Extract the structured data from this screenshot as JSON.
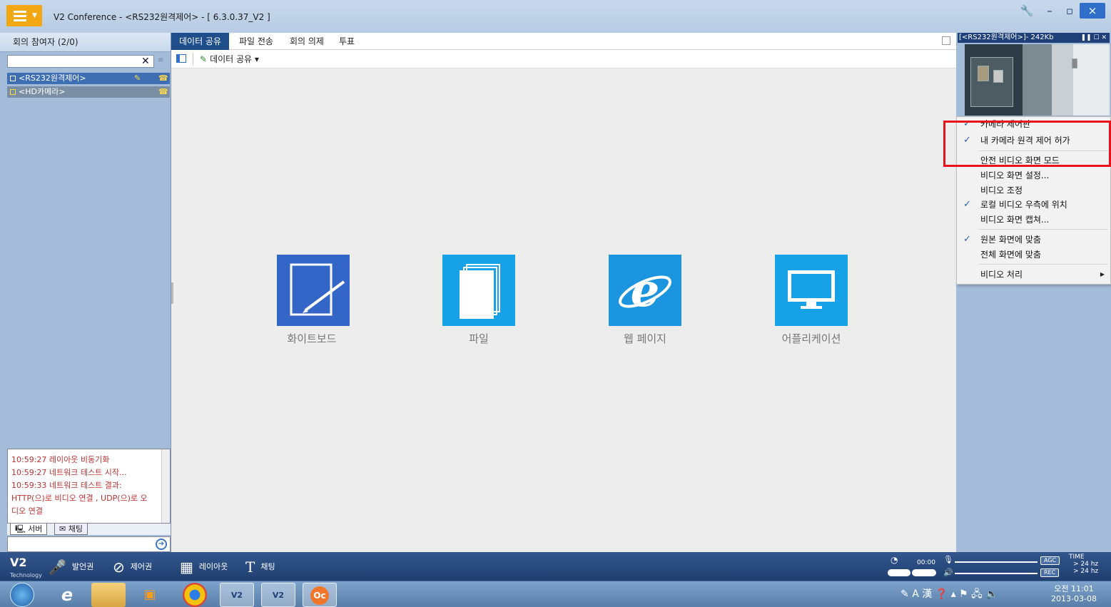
{
  "window": {
    "title": "V2 Conference - <RS232원격제어> - [ 6.3.0.37_V2 ]",
    "controls": {
      "settings": "🔧",
      "minimize": "–",
      "restore": "▫",
      "close": "×"
    }
  },
  "left_panel": {
    "header": "회의 참여자 (2/0)",
    "search_value": "",
    "participants": [
      {
        "name": "<RS232원격제어>",
        "selected": true
      },
      {
        "name": "<HD카메라>",
        "selected": false
      }
    ],
    "log_lines": [
      "10:59:27   레이아웃 비동기화",
      "10:59:27   네트워크 테스트 시작...",
      "10:59:33   네트워크 테스트 결과:",
      "HTTP(으)로 비디오 연결 ,  UDP(으)로 오",
      "디오 연결"
    ],
    "log_tabs": {
      "server": "서버",
      "chat": "채팅"
    }
  },
  "main": {
    "tabs": [
      "데이터 공유",
      "파일 전송",
      "회의 의제",
      "투표"
    ],
    "active_tab": "데이터 공유",
    "toolbar": {
      "share_label": "데이터 공유"
    },
    "apps": [
      {
        "label": "화이트보드",
        "icon": "whiteboard-icon",
        "color": "#3366c6"
      },
      {
        "label": "파일",
        "icon": "file-icon",
        "color": "#17a1e6"
      },
      {
        "label": "웹 페이지",
        "icon": "ie-browser-icon",
        "color": "#1b95e0"
      },
      {
        "label": "어플리케이션",
        "icon": "monitor-icon",
        "color": "#17a1e6"
      }
    ]
  },
  "video": {
    "header": "[<RS232원격제어>]- 242Kb"
  },
  "context_menu": {
    "items": [
      {
        "label": "카메라 제어판",
        "checked": true
      },
      {
        "label": "내 카메라 원격 제어 허가",
        "checked": true
      },
      {
        "label": "안전 비디오 화면 모드",
        "checked": false
      },
      {
        "label": "비디오 화면 설정...",
        "checked": false
      },
      {
        "label": "비디오 조정",
        "checked": false
      },
      {
        "label": "로컬 비디오 우측에 위치",
        "checked": true
      },
      {
        "label": "비디오 화면 캡쳐...",
        "checked": false
      },
      {
        "label": "원본 화면에 맞춤",
        "checked": true
      },
      {
        "label": "전체 화면에 맞춤",
        "checked": false
      },
      {
        "label": "비디오 처리",
        "checked": false,
        "submenu": true
      }
    ],
    "highlight_color": "#e8141b"
  },
  "bottom_toolbar": {
    "logo_text": "Technology",
    "items": [
      "발언권",
      "제어권",
      "레이아웃",
      "채팅"
    ],
    "timer": "00:00",
    "agc": "AGC",
    "rec": "REC",
    "time_label": "TIME",
    "fps1": "> 24 hz",
    "fps2": "> 24 hz"
  },
  "taskbar": {
    "tray_text": "A 漢",
    "clock_time": "오전 11:01",
    "clock_date": "2013-03-08"
  },
  "colors": {
    "title_accent": "#f3a712",
    "active_tab": "#1f4f8b",
    "panel_bg": "#a4bcd9",
    "bottom_bar": "#203f70"
  }
}
